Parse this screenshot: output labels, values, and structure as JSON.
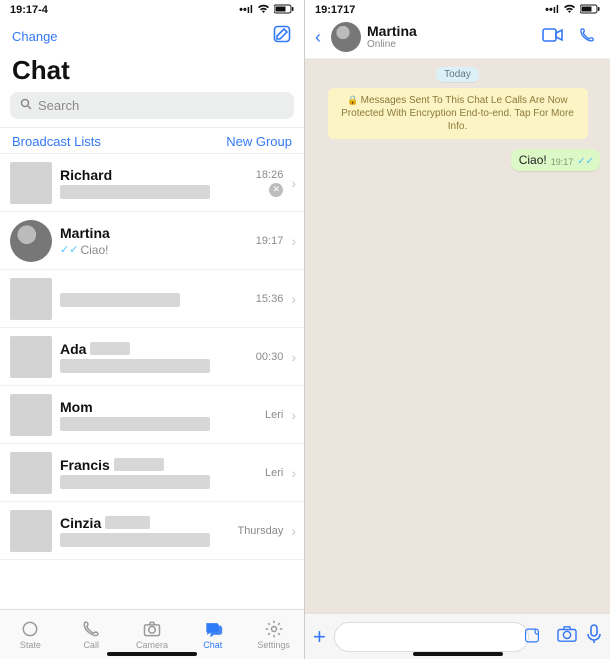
{
  "left": {
    "status_time": "19:17-4",
    "nav_change": "Change",
    "title": "Chat",
    "search_placeholder": "Search",
    "broadcast": "Broadcast Lists",
    "new_group": "New Group",
    "chats": [
      {
        "name": "Richard",
        "time": "18:26",
        "avatar": "square",
        "muted": true
      },
      {
        "name": "Martina",
        "time": "19:17",
        "avatar": "photo",
        "preview_text": "Ciao!",
        "read": true
      },
      {
        "name": "",
        "time": "15:36",
        "avatar": "square"
      },
      {
        "name": "Ada",
        "time": "00:30",
        "avatar": "square",
        "name_redact": true
      },
      {
        "name": "Mom",
        "time": "Leri",
        "avatar": "square"
      },
      {
        "name": "Francis",
        "time": "Leri",
        "avatar": "square",
        "name_redact": true
      },
      {
        "name": "Cinzia",
        "time": "Thursday",
        "avatar": "square",
        "name_redact": true
      }
    ],
    "tabs": {
      "state": "State",
      "call": "Call",
      "camera": "Camera",
      "chat": "Chat",
      "settings": "Settings"
    }
  },
  "right": {
    "status_time": "19:1717",
    "contact_name": "Martina",
    "contact_status": "Online",
    "date_label": "Today",
    "encryption_notice": "Messages Sent To This Chat Le Calls Are Now Protected With Encryption End-to-end. Tap For More Info.",
    "messages": [
      {
        "direction": "out",
        "text": "Ciao!",
        "time": "19:17",
        "status": "read"
      }
    ]
  }
}
